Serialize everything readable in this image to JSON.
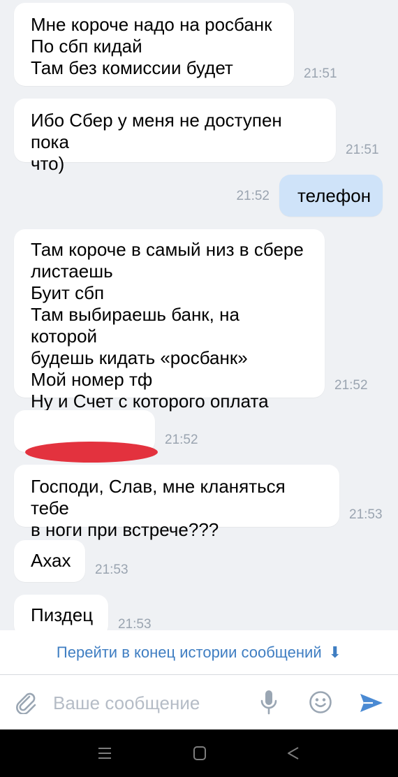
{
  "messages": [
    {
      "text": "Мне короче надо на росбанк\nПо сбп кидай\nТам без комиссии будет",
      "time": "21:51"
    },
    {
      "text": "Ибо Сбер у меня не доступен пока\nчто)",
      "time": "21:51"
    },
    {
      "text": "телефон",
      "time": "21:52"
    },
    {
      "text": "Там короче в самый низ в сбере\nлистаешь\nБуит сбп\nТам выбираешь банк, на которой\nбудешь кидать «росбанк»\nМой номер тф\nНу и Счет с которого оплата",
      "time": "21:52"
    },
    {
      "text": "",
      "time": "21:52"
    },
    {
      "text": "Господи, Слав, мне кланяться тебе\nв ноги при встрече???",
      "time": "21:53"
    },
    {
      "text": "Ахах",
      "time": "21:53"
    },
    {
      "text": "Пиздец",
      "time": "21:53"
    }
  ],
  "jump_to_end": {
    "label": "Перейти в конец истории сообщений",
    "arrow": "⬇"
  },
  "composer": {
    "placeholder": "Ваше сообщение"
  },
  "icons": {
    "attach": "paperclip-icon",
    "mic": "microphone-icon",
    "emoji": "smile-icon",
    "send": "send-icon",
    "nav_menu": "menu-icon",
    "nav_home": "home-icon",
    "nav_back": "back-icon"
  },
  "colors": {
    "background": "#eff1f4",
    "incoming_bubble": "#ffffff",
    "outgoing_bubble": "#cfe3f9",
    "link": "#3f7ec2",
    "time": "#9aa4b0",
    "redaction": "#e3323e"
  }
}
